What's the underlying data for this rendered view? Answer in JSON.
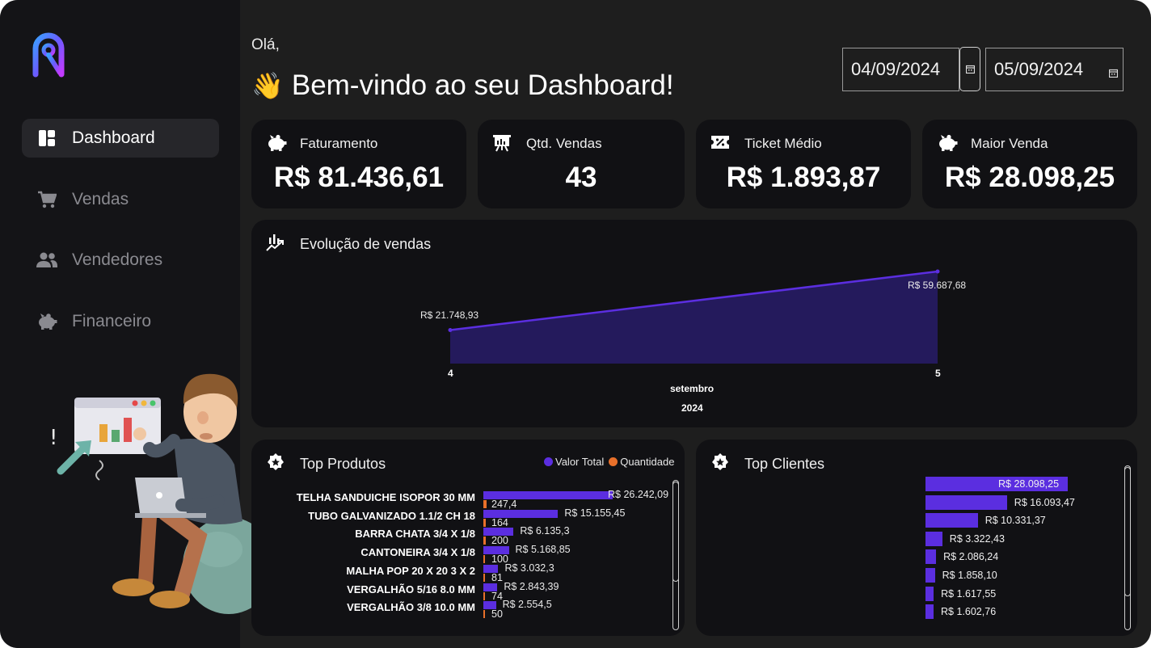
{
  "sidebar": {
    "logo_icon": "r-logo-icon",
    "items": [
      {
        "label": "Dashboard",
        "icon": "dashboard-icon",
        "active": true
      },
      {
        "label": "Vendas",
        "icon": "cart-icon"
      },
      {
        "label": "Vendedores",
        "icon": "people-icon"
      },
      {
        "label": "Financeiro",
        "icon": "piggy-bank-icon"
      }
    ]
  },
  "header": {
    "greeting": "Olá,",
    "wave_emoji": "👋",
    "welcome": "Bem-vindo ao seu Dashboard!"
  },
  "date_filter": {
    "start": "04/09/2024",
    "end": "05/09/2024"
  },
  "kpis": [
    {
      "label": "Faturamento",
      "value": "R$ 81.436,61",
      "icon": "piggy-bank-icon"
    },
    {
      "label": "Qtd. Vendas",
      "value": "43",
      "icon": "presentation-icon"
    },
    {
      "label": "Ticket Médio",
      "value": "R$ 1.893,87",
      "icon": "ticket-icon"
    },
    {
      "label": "Maior Venda",
      "value": "R$ 28.098,25",
      "icon": "piggy-bank-icon"
    }
  ],
  "evolution": {
    "title": "Evolução de vendas",
    "icon": "trend-icon",
    "month_label": "setembro",
    "year_label": "2024"
  },
  "top_produtos": {
    "title": "Top Produtos",
    "icon": "star-badge-icon",
    "legend_valor": "Valor Total",
    "legend_qtd": "Quantidade",
    "items": [
      {
        "name": "TELHA SANDUICHE ISOPOR 30 MM",
        "valor": 26242.09,
        "valor_label": "R$ 26.242,09",
        "qtd": 247.4,
        "qtd_label": "247,4"
      },
      {
        "name": "TUBO GALVANIZADO 1.1/2 CH 18",
        "valor": 15155.45,
        "valor_label": "R$ 15.155,45",
        "qtd": 164,
        "qtd_label": "164"
      },
      {
        "name": "BARRA CHATA 3/4 X 1/8",
        "valor": 6135.3,
        "valor_label": "R$ 6.135,3",
        "qtd": 200,
        "qtd_label": "200"
      },
      {
        "name": "CANTONEIRA 3/4 X 1/8",
        "valor": 5168.85,
        "valor_label": "R$ 5.168,85",
        "qtd": 100,
        "qtd_label": "100"
      },
      {
        "name": "MALHA POP 20 X 20 3 X 2",
        "valor": 3032.3,
        "valor_label": "R$ 3.032,3",
        "qtd": 81,
        "qtd_label": "81"
      },
      {
        "name": "VERGALHÃO 5/16 8.0 MM",
        "valor": 2843.39,
        "valor_label": "R$ 2.843,39",
        "qtd": 74,
        "qtd_label": "74"
      },
      {
        "name": "VERGALHÃO 3/8 10.0 MM",
        "valor": 2554.5,
        "valor_label": "R$ 2.554,5",
        "qtd": 50,
        "qtd_label": "50"
      }
    ]
  },
  "top_clientes": {
    "title": "Top Clientes",
    "icon": "star-badge-icon",
    "items": [
      {
        "value": 28098.25,
        "label": "R$ 28.098,25"
      },
      {
        "value": 16093.47,
        "label": "R$ 16.093,47"
      },
      {
        "value": 10331.37,
        "label": "R$ 10.331,37"
      },
      {
        "value": 3322.43,
        "label": "R$ 3.322,43"
      },
      {
        "value": 2086.24,
        "label": "R$ 2.086,24"
      },
      {
        "value": 1858.1,
        "label": "R$ 1.858,10"
      },
      {
        "value": 1617.55,
        "label": "R$ 1.617,55"
      },
      {
        "value": 1602.76,
        "label": "R$ 1.602,76"
      }
    ]
  },
  "chart_data": [
    {
      "type": "area",
      "title": "Evolução de vendas",
      "x": [
        4,
        5
      ],
      "x_tick_labels": [
        "4",
        "5"
      ],
      "xlabel": "setembro",
      "xlabel2": "2024",
      "series": [
        {
          "values": [
            21748.93,
            59687.68
          ]
        }
      ],
      "data_labels": [
        "R$ 21.748,93",
        "R$ 59.687,68"
      ],
      "color": "#5b2ee0"
    },
    {
      "type": "bar",
      "title": "Top Produtos",
      "categories": [
        "TELHA SANDUICHE ISOPOR 30 MM",
        "TUBO GALVANIZADO 1.1/2 CH 18",
        "BARRA CHATA 3/4 X 1/8",
        "CANTONEIRA 3/4 X 1/8",
        "MALHA POP 20 X 20 3 X 2",
        "VERGALHÃO 5/16 8.0 MM",
        "VERGALHÃO 3/8 10.0 MM"
      ],
      "series": [
        {
          "name": "Valor Total",
          "values": [
            26242.09,
            15155.45,
            6135.3,
            5168.85,
            3032.3,
            2843.39,
            2554.5
          ],
          "color": "#5b2ee0"
        },
        {
          "name": "Quantidade",
          "values": [
            247.4,
            164,
            200,
            100,
            81,
            74,
            50
          ],
          "color": "#e8702a"
        }
      ],
      "legend": "top-right"
    },
    {
      "type": "bar",
      "title": "Top Clientes",
      "series": [
        {
          "values": [
            28098.25,
            16093.47,
            10331.37,
            3322.43,
            2086.24,
            1858.1,
            1617.55,
            1602.76
          ],
          "color": "#5b2ee0"
        }
      ]
    }
  ]
}
